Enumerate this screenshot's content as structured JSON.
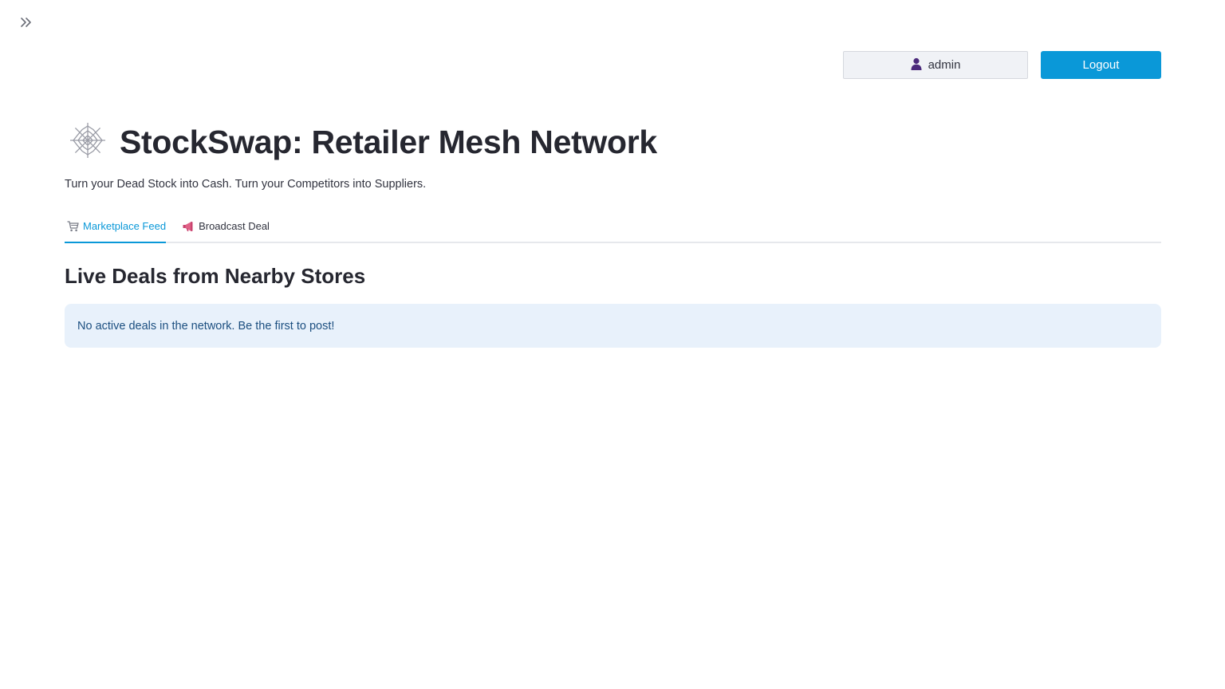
{
  "sidebar_toggle": {
    "icon": "double-chevron-right-icon"
  },
  "header": {
    "user": {
      "icon": "user-icon",
      "name": "admin"
    },
    "logout_label": "Logout"
  },
  "app": {
    "title_icon": "spider-web-icon",
    "title": "StockSwap: Retailer Mesh Network",
    "tagline": "Turn your Dead Stock into Cash. Turn your Competitors into Suppliers."
  },
  "tabs": [
    {
      "icon": "shopping-cart-icon",
      "label": "Marketplace Feed",
      "active": true
    },
    {
      "icon": "megaphone-icon",
      "label": "Broadcast Deal",
      "active": false
    }
  ],
  "main": {
    "section_heading": "Live Deals from Nearby Stores",
    "info_message": "No active deals in the network. Be the first to post!"
  },
  "colors": {
    "accent": "#0a98d8",
    "info_bg": "#e8f1fb",
    "info_text": "#1c4f80",
    "user_icon": "#4b2a7b"
  }
}
